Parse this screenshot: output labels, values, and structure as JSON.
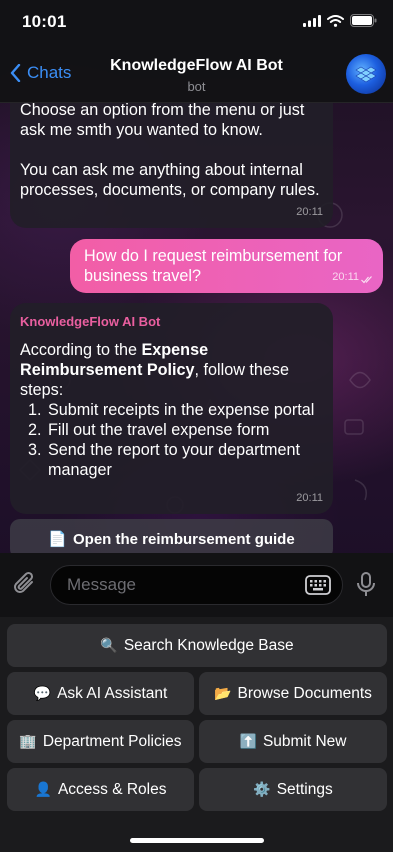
{
  "status_bar": {
    "time": "10:01"
  },
  "header": {
    "back_label": "Chats",
    "title": "KnowledgeFlow AI Bot",
    "subtitle": "bot"
  },
  "messages": [
    {
      "direction": "incoming",
      "text_line1": "Choose an option from the menu or just ask me smth you wanted to know.",
      "text_line2": "You can ask me anything about internal processes, documents, or company rules.",
      "time": "20:11"
    },
    {
      "direction": "outgoing",
      "text": "How do I request reimbursement for business travel?",
      "time": "20:11",
      "status": "read"
    },
    {
      "direction": "incoming",
      "sender": "KnowledgeFlow AI Bot",
      "intro_prefix": "According to the ",
      "intro_bold": "Expense Reimbursement Policy",
      "intro_suffix": ", follow these steps:",
      "steps": [
        "Submit receipts in the expense portal",
        "Fill out the travel expense form",
        "Send the report to your department manager"
      ],
      "time": "20:11"
    }
  ],
  "inline_button": {
    "icon": "📄",
    "label": "Open the reimbursement guide"
  },
  "input": {
    "placeholder": "Message"
  },
  "keyboard": [
    {
      "icon": "🔍",
      "label": "Search Knowledge Base"
    },
    {
      "icon": "💬",
      "label": "Ask AI Assistant"
    },
    {
      "icon": "📂",
      "label": "Browse Documents"
    },
    {
      "icon": "🏢",
      "label": "Department Policies"
    },
    {
      "icon": "⬆️",
      "label": "Submit New"
    },
    {
      "icon": "👤",
      "label": "Access & Roles"
    },
    {
      "icon": "⚙️",
      "label": "Settings"
    }
  ],
  "colors": {
    "accent_blue": "#3b8ef5",
    "outgoing_bubble": "#f25ea6",
    "sender_name": "#ea5fa0"
  }
}
